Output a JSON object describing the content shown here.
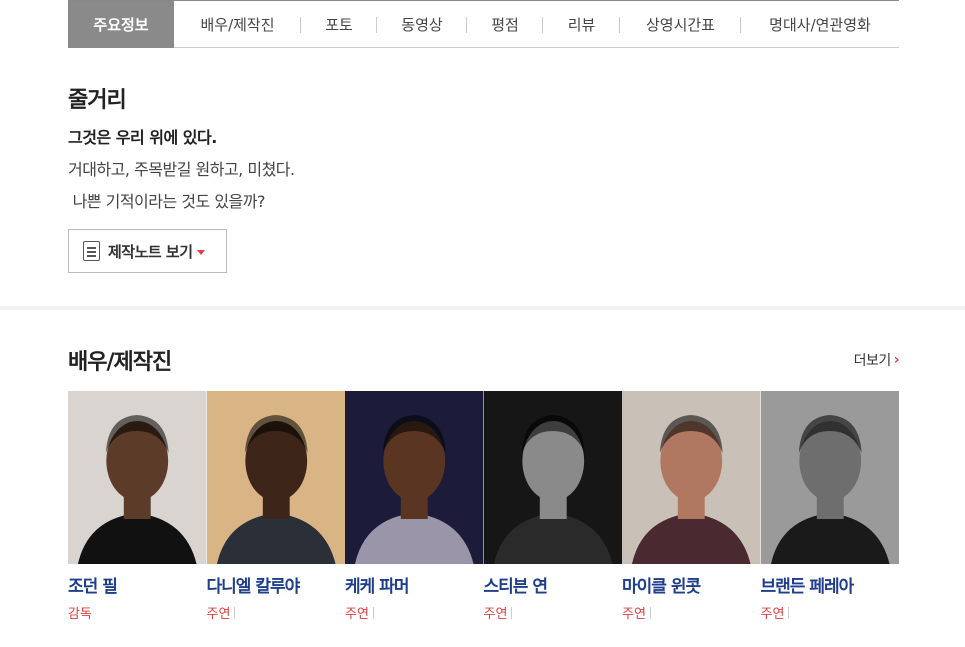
{
  "tabs": [
    {
      "label": "주요정보",
      "active": true,
      "w": 106
    },
    {
      "label": "배우/제작진",
      "w": 127
    },
    {
      "label": "포토",
      "w": 76
    },
    {
      "label": "동영상",
      "w": 90
    },
    {
      "label": "평점",
      "w": 76
    },
    {
      "label": "리뷰",
      "w": 77
    },
    {
      "label": "상영시간표",
      "w": 121
    },
    {
      "label": "명대사/연관영화",
      "w": 158
    }
  ],
  "synopsis": {
    "title": "줄거리",
    "headline": "그것은 우리 위에 있다.",
    "lines": [
      "거대하고, 주목받길 원하고, 미쳤다.",
      " 나쁜 기적이라는 것도 있을까?"
    ],
    "note_button": "제작노트 보기"
  },
  "cast": {
    "title": "배우/제작진",
    "more": "더보기",
    "people": [
      {
        "name": "조던 필",
        "role": "감독",
        "bg": "#d9d4cf",
        "skin": "#5c3b28",
        "suit": "#111"
      },
      {
        "name": "다니엘 칼루야",
        "role": "주연",
        "bg": "#d9b585",
        "skin": "#3d2619",
        "suit": "#2a2f38"
      },
      {
        "name": "케케 파머",
        "role": "주연",
        "bg": "#1c1c3a",
        "skin": "#5a3522",
        "suit": "#9a95a8"
      },
      {
        "name": "스티븐 연",
        "role": "주연",
        "bg": "#161616",
        "skin": "#8a8a8a",
        "suit": "#2a2a2a"
      },
      {
        "name": "마이클 윈콧",
        "role": "주연",
        "bg": "#c9c0b8",
        "skin": "#b07860",
        "suit": "#4a2a30"
      },
      {
        "name": "브랜든 페레아",
        "role": "주연",
        "bg": "#9a9a9a",
        "skin": "#6e6e6e",
        "suit": "#1a1a1a"
      }
    ]
  }
}
